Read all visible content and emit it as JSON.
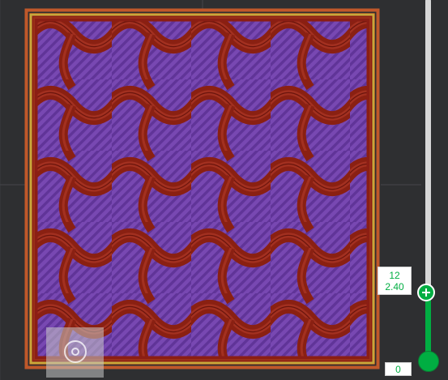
{
  "layer_slider": {
    "top_layer_number": "12",
    "top_layer_height": "2.40",
    "bottom_layer_number": "0",
    "accent_color": "#00ae42"
  },
  "preview": {
    "infill_pattern": "gyroid",
    "wall_color": "#8b1e14",
    "infill_color": "#7a48b4",
    "outer_wall_color": "#c8a83a",
    "skirt_color": "#c0582a"
  },
  "navigation": {
    "gizmo_icon": "orbit-gizmo-icon"
  }
}
